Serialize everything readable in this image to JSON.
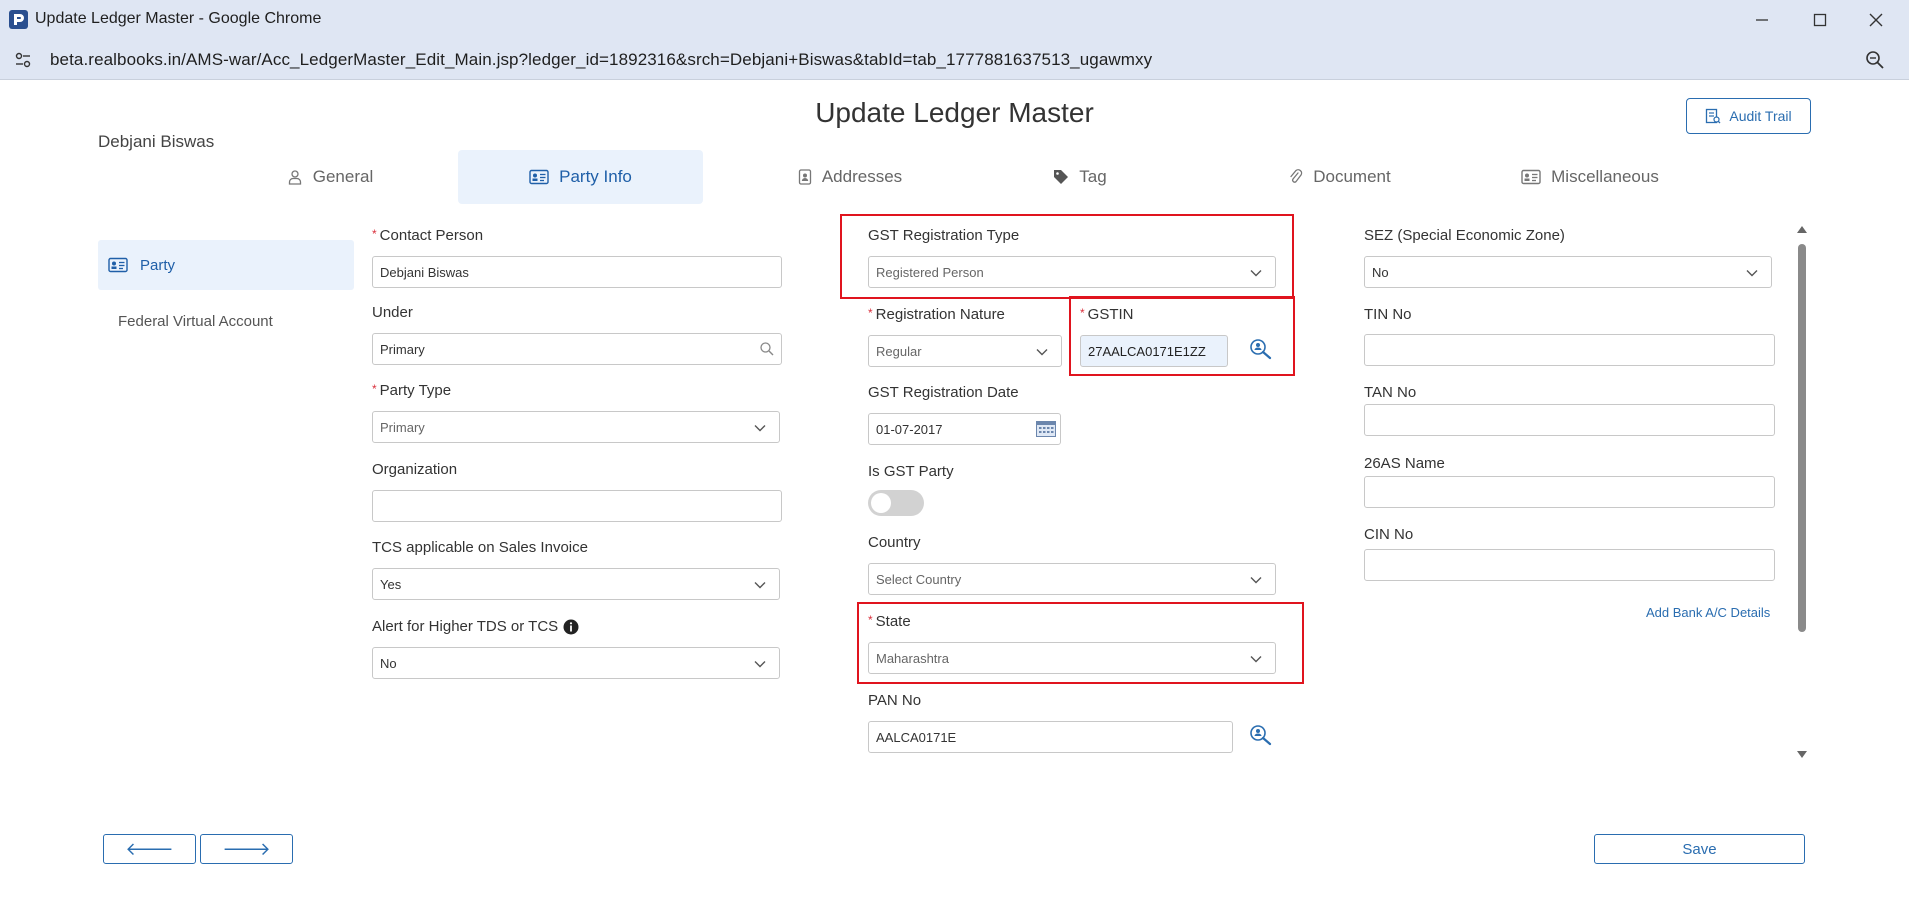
{
  "window": {
    "title": "Update Ledger Master - Google Chrome",
    "url": "beta.realbooks.in/AMS-war/Acc_LedgerMaster_Edit_Main.jsp?ledger_id=1892316&srch=Debjani+Biswas&tabId=tab_1777881637513_ugawmxy"
  },
  "header": {
    "title": "Update Ledger Master",
    "audit_trail_label": "Audit Trail",
    "ledger_name": "Debjani Biswas"
  },
  "tabs": [
    {
      "label": "General",
      "icon": "user-icon"
    },
    {
      "label": "Party Info",
      "icon": "id-card-icon"
    },
    {
      "label": "Addresses",
      "icon": "contact-book-icon"
    },
    {
      "label": "Tag",
      "icon": "tag-icon"
    },
    {
      "label": "Document",
      "icon": "paperclip-icon"
    },
    {
      "label": "Miscellaneous",
      "icon": "id-card-icon"
    }
  ],
  "sidebar": {
    "items": [
      {
        "label": "Party",
        "icon": "id-card-icon"
      },
      {
        "label": "Federal Virtual Account"
      }
    ]
  },
  "form": {
    "contact_person": {
      "label": "Contact Person",
      "value": "Debjani Biswas"
    },
    "under": {
      "label": "Under",
      "value": "Primary"
    },
    "party_type": {
      "label": "Party Type",
      "value": "Primary"
    },
    "organization": {
      "label": "Organization",
      "value": ""
    },
    "tcs_applicable": {
      "label": "TCS applicable on Sales Invoice",
      "value": "Yes"
    },
    "alert_higher_tds": {
      "label": "Alert for Higher TDS or TCS",
      "value": "No"
    },
    "gst_registration_type": {
      "label": "GST Registration Type",
      "value": "Registered Person"
    },
    "registration_nature": {
      "label": "Registration Nature",
      "value": "Regular"
    },
    "gstin": {
      "label": "GSTIN",
      "value": "27AALCA0171E1ZZ"
    },
    "gst_registration_date": {
      "label": "GST Registration Date",
      "value": "01-07-2017"
    },
    "is_gst_party": {
      "label": "Is GST Party",
      "on": false
    },
    "country": {
      "label": "Country",
      "value": "Select Country"
    },
    "state": {
      "label": "State",
      "value": "Maharashtra"
    },
    "pan_no": {
      "label": "PAN No",
      "value": "AALCA0171E"
    },
    "sez": {
      "label": "SEZ (Special Economic Zone)",
      "value": "No"
    },
    "tin_no": {
      "label": "TIN No",
      "value": ""
    },
    "tan_no": {
      "label": "TAN No",
      "value": ""
    },
    "as26_name": {
      "label": "26AS Name",
      "value": ""
    },
    "cin_no": {
      "label": "CIN No",
      "value": ""
    },
    "add_bank_link": "Add Bank A/C Details"
  },
  "footer": {
    "prev_symbol": "🡐",
    "next_symbol": "🡒",
    "save_label": "Save"
  },
  "colors": {
    "accent": "#2a6db0",
    "active_tab_bg": "#eaf2fc",
    "highlight": "#e0141e",
    "required": "#d9303c"
  }
}
